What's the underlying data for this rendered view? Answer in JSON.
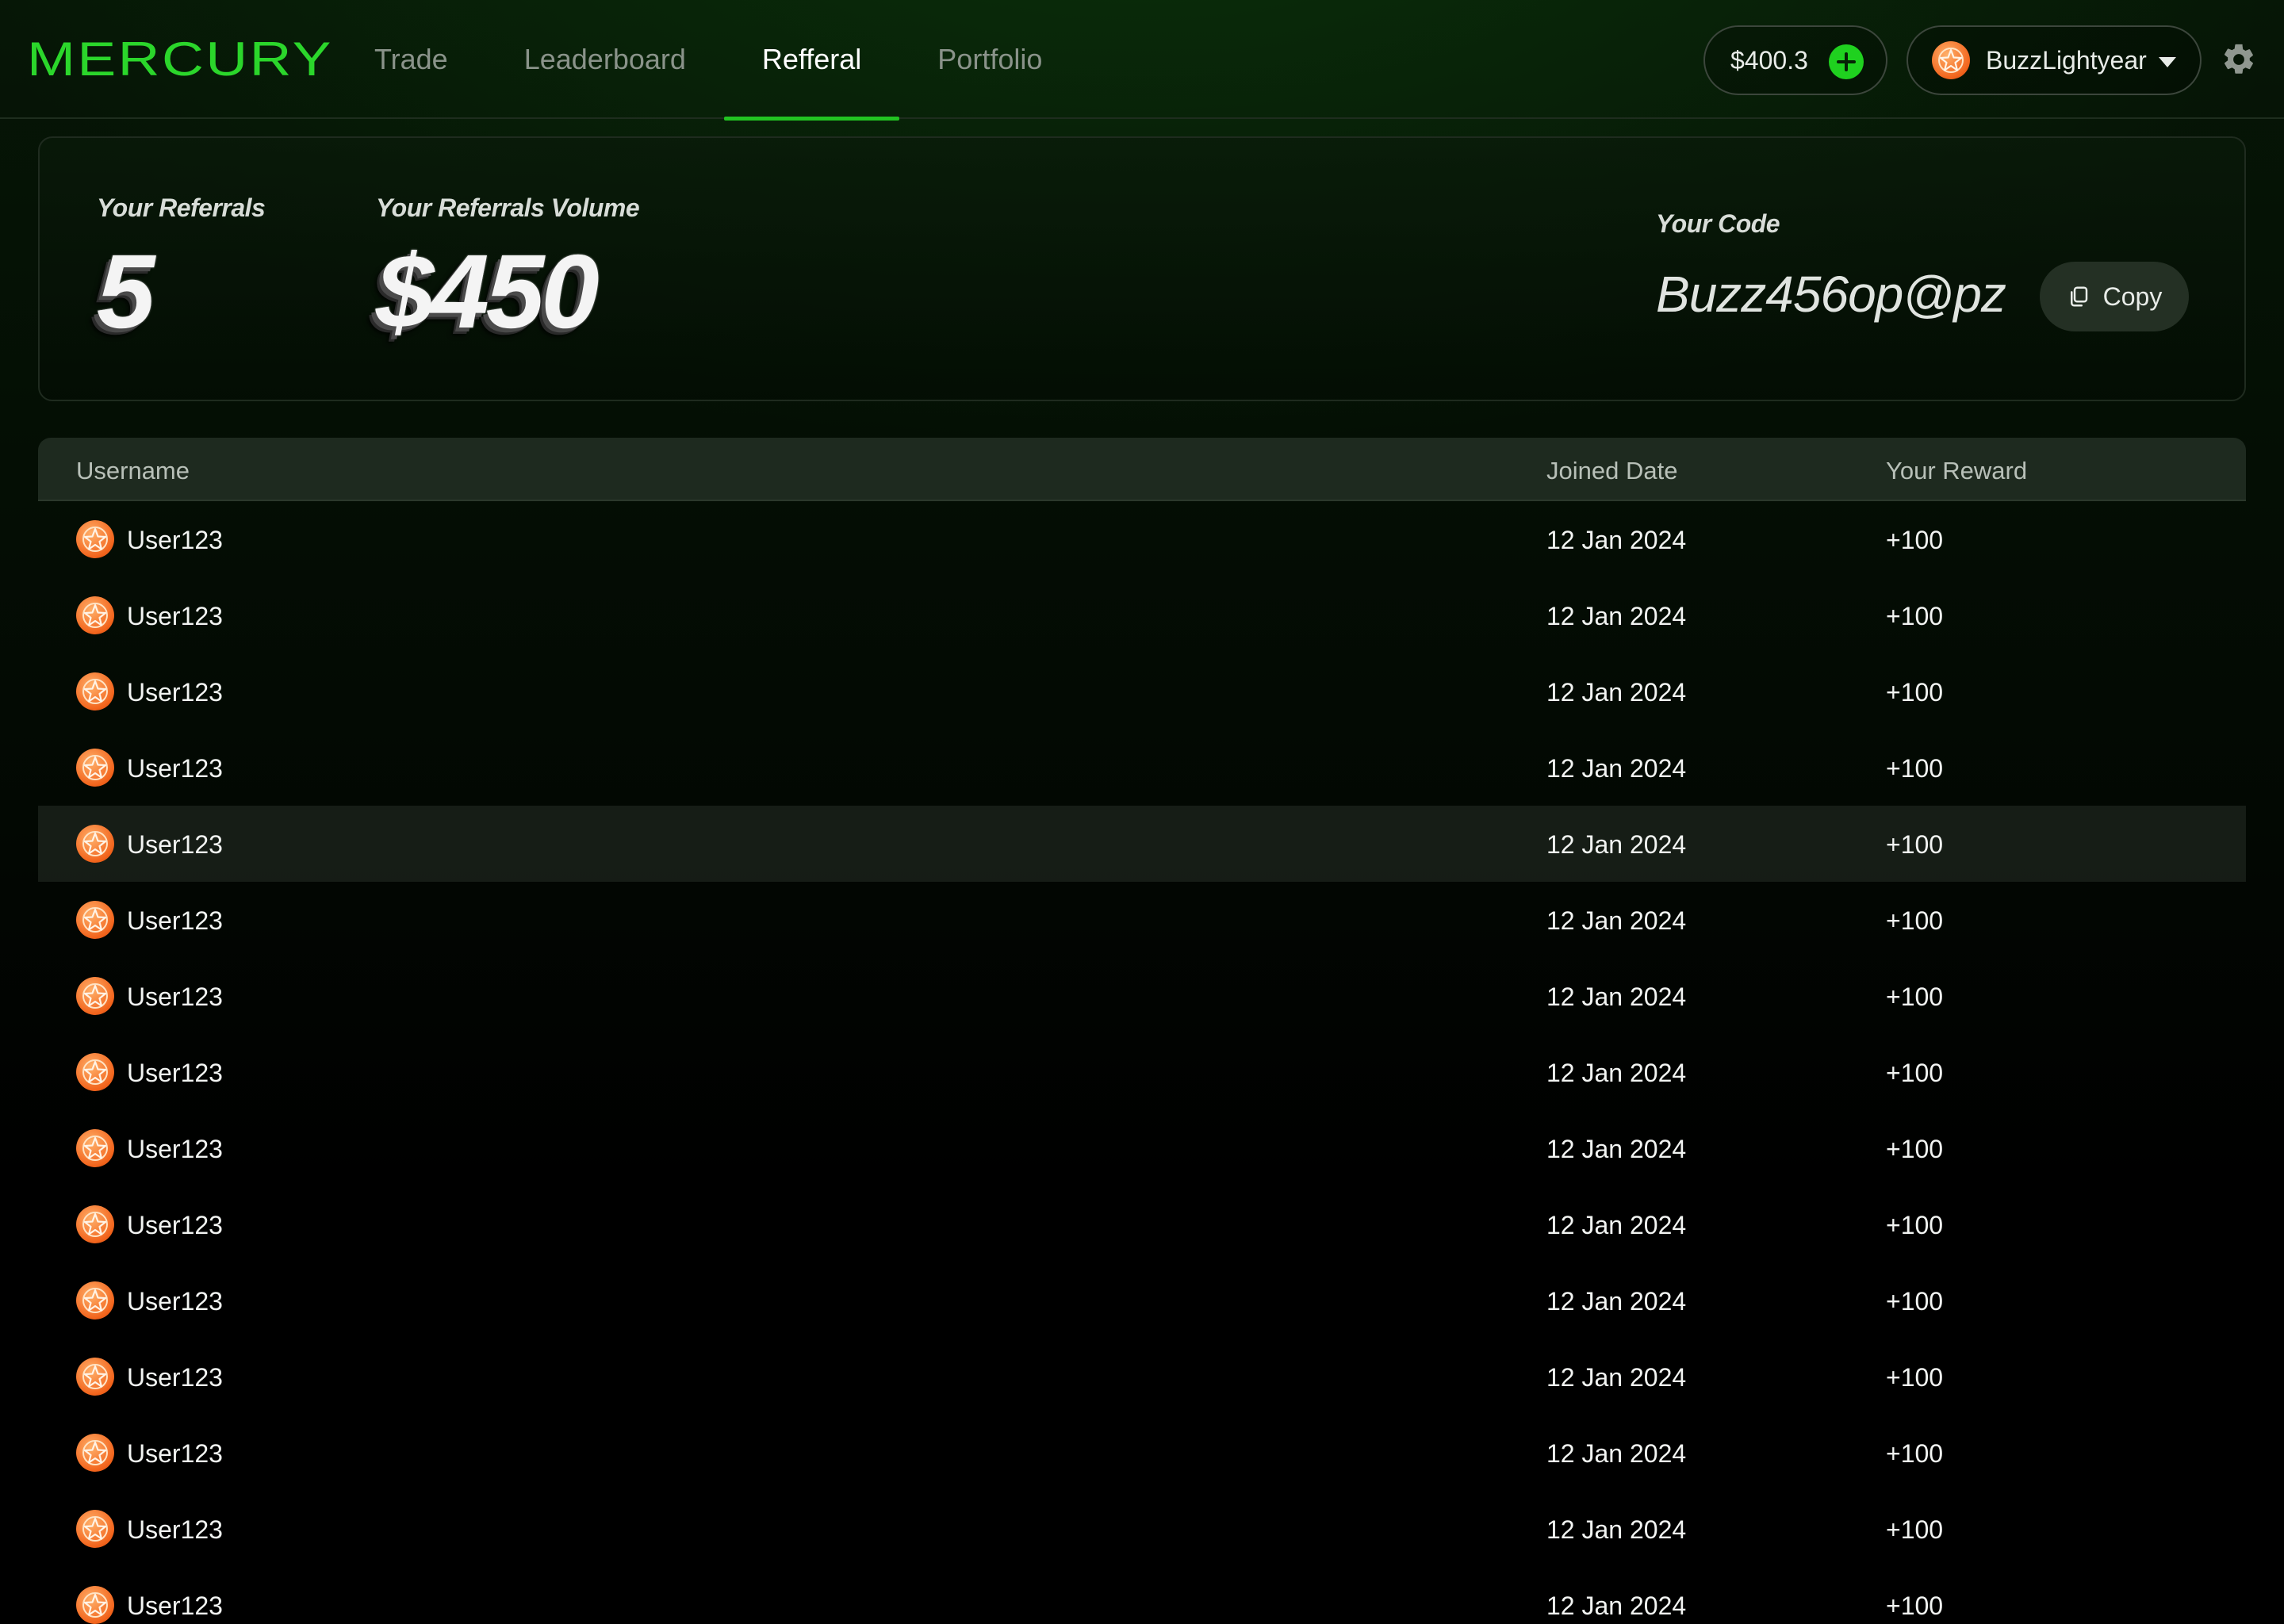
{
  "brand": {
    "logo": "MERCURY",
    "accent": "#2bd62b"
  },
  "nav": {
    "tabs": [
      "Trade",
      "Leaderboard",
      "Refferal",
      "Portfolio"
    ],
    "active": "Refferal"
  },
  "header": {
    "balance": "$400.3",
    "username": "BuzzLightyear"
  },
  "stats": {
    "referrals_label": "Your Referrals",
    "referrals_value": "5",
    "volume_label": "Your Referrals Volume",
    "volume_value": "$450",
    "code_label": "Your Code",
    "code_value": "Buzz456op@pz",
    "copy_label": "Copy"
  },
  "table": {
    "columns": [
      "Username",
      "Joined Date",
      "Your Reward"
    ],
    "highlighted_row": 4,
    "rows": [
      {
        "username": "User123",
        "joined": "12 Jan 2024",
        "reward": "+100"
      },
      {
        "username": "User123",
        "joined": "12 Jan 2024",
        "reward": "+100"
      },
      {
        "username": "User123",
        "joined": "12 Jan 2024",
        "reward": "+100"
      },
      {
        "username": "User123",
        "joined": "12 Jan 2024",
        "reward": "+100"
      },
      {
        "username": "User123",
        "joined": "12 Jan 2024",
        "reward": "+100"
      },
      {
        "username": "User123",
        "joined": "12 Jan 2024",
        "reward": "+100"
      },
      {
        "username": "User123",
        "joined": "12 Jan 2024",
        "reward": "+100"
      },
      {
        "username": "User123",
        "joined": "12 Jan 2024",
        "reward": "+100"
      },
      {
        "username": "User123",
        "joined": "12 Jan 2024",
        "reward": "+100"
      },
      {
        "username": "User123",
        "joined": "12 Jan 2024",
        "reward": "+100"
      },
      {
        "username": "User123",
        "joined": "12 Jan 2024",
        "reward": "+100"
      },
      {
        "username": "User123",
        "joined": "12 Jan 2024",
        "reward": "+100"
      },
      {
        "username": "User123",
        "joined": "12 Jan 2024",
        "reward": "+100"
      },
      {
        "username": "User123",
        "joined": "12 Jan 2024",
        "reward": "+100"
      },
      {
        "username": "User123",
        "joined": "12 Jan 2024",
        "reward": "+100"
      }
    ]
  },
  "icons": {
    "add_funds": "plus-icon",
    "menu": "chevron-down-icon",
    "settings": "gear-icon",
    "copy": "copy-icon",
    "avatar": "star-avatar-icon"
  }
}
